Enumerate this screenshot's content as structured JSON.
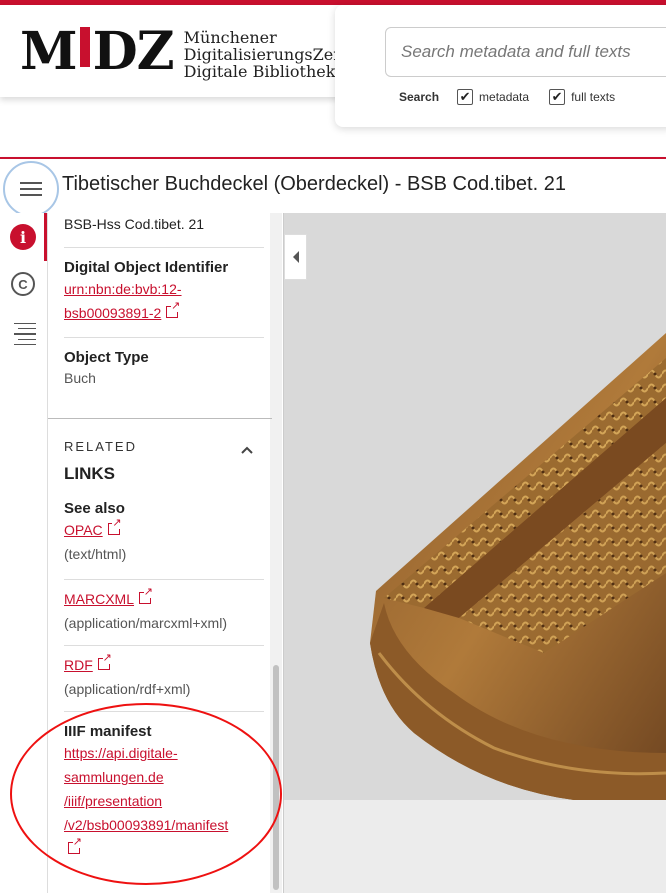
{
  "header": {
    "logo_mark": "MDZ",
    "logo_lines": [
      "Münchener",
      "DigitalisierungsZentrum",
      "Digitale Bibliothek"
    ]
  },
  "search": {
    "placeholder": "Search metadata and full texts",
    "label": "Search",
    "options": [
      {
        "label": "metadata",
        "checked": true
      },
      {
        "label": "full texts",
        "checked": true
      }
    ]
  },
  "title": "Tibetischer Buchdeckel (Oberdeckel) - BSB Cod.tibet. 21",
  "sidebar": {
    "shelfmark": "BSB-Hss Cod.tibet. 21",
    "doi": {
      "label": "Digital Object Identifier",
      "value_lines": [
        "urn:nbn:de:bvb:12-",
        "bsb00093891-2"
      ]
    },
    "object_type": {
      "label": "Object Type",
      "value": "Buch"
    },
    "related": {
      "small": "RELATED",
      "big": "LINKS"
    },
    "see_also": {
      "label": "See also",
      "links": [
        {
          "text": "OPAC",
          "mime": "(text/html)"
        },
        {
          "text": "MARCXML",
          "mime": "(application/marcxml+xml)"
        },
        {
          "text": "RDF",
          "mime": "(application/rdf+xml)"
        }
      ]
    },
    "iiif": {
      "label": "IIIF manifest",
      "url_lines": [
        "https://api.digitale-",
        "sammlungen.de",
        "/iiif/presentation",
        "/v2/bsb00093891/manifest"
      ]
    }
  },
  "icons": {
    "menu": "hamburger-icon",
    "info": "info-icon",
    "copyright": "copyright-icon",
    "toc": "toc-icon",
    "external": "external-link-icon",
    "collapse": "caret-left-icon",
    "chevron": "chevron-up-icon"
  },
  "colors": {
    "accent": "#c8102e",
    "focus_ring": "#a8c6e6",
    "annotation": "#ee1111"
  }
}
